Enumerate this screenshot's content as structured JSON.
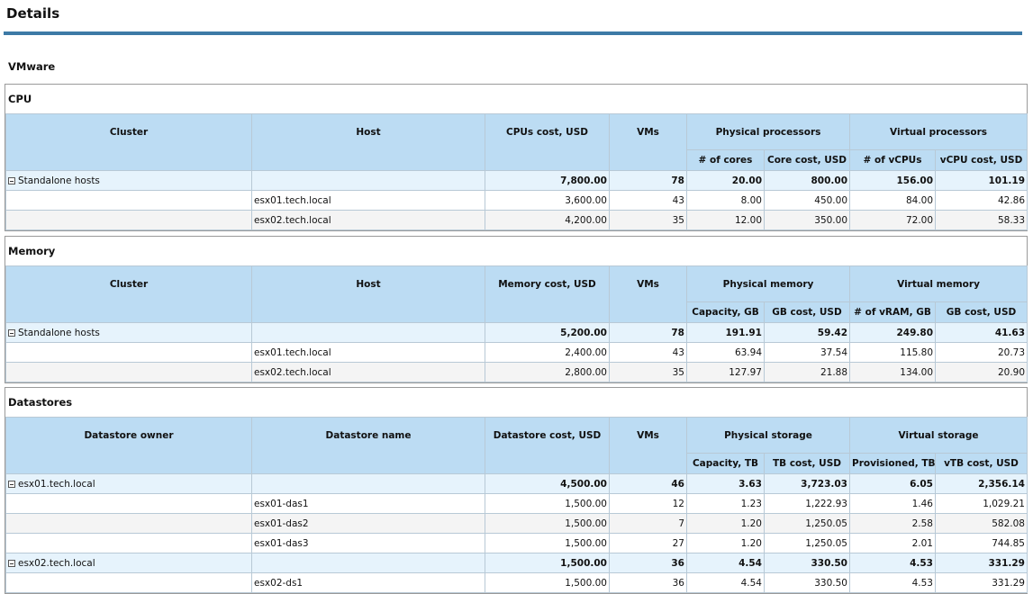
{
  "page": {
    "title": "Details",
    "section": "VMware"
  },
  "cpu": {
    "title": "CPU",
    "headers": {
      "cluster": "Cluster",
      "host": "Host",
      "cost": "CPUs cost, USD",
      "vms": "VMs",
      "phys_group": "Physical processors",
      "virt_group": "Virtual processors",
      "p1": "# of cores",
      "p2": "Core cost, USD",
      "v1": "# of vCPUs",
      "v2": "vCPU cost, USD"
    },
    "rows": [
      {
        "group": true,
        "c0": "Standalone hosts",
        "c1": "",
        "c2": "7,800.00",
        "c3": "78",
        "c4": "20.00",
        "c5": "800.00",
        "c6": "156.00",
        "c7": "101.19"
      },
      {
        "group": false,
        "c0": "",
        "c1": "esx01.tech.local",
        "c2": "3,600.00",
        "c3": "43",
        "c4": "8.00",
        "c5": "450.00",
        "c6": "84.00",
        "c7": "42.86"
      },
      {
        "group": false,
        "c0": "",
        "c1": "esx02.tech.local",
        "c2": "4,200.00",
        "c3": "35",
        "c4": "12.00",
        "c5": "350.00",
        "c6": "72.00",
        "c7": "58.33"
      }
    ]
  },
  "memory": {
    "title": "Memory",
    "headers": {
      "cluster": "Cluster",
      "host": "Host",
      "cost": "Memory cost, USD",
      "vms": "VMs",
      "phys_group": "Physical memory",
      "virt_group": "Virtual memory",
      "p1": "Capacity, GB",
      "p2": "GB cost, USD",
      "v1": "# of vRAM, GB",
      "v2": "GB cost, USD"
    },
    "rows": [
      {
        "group": true,
        "c0": "Standalone hosts",
        "c1": "",
        "c2": "5,200.00",
        "c3": "78",
        "c4": "191.91",
        "c5": "59.42",
        "c6": "249.80",
        "c7": "41.63"
      },
      {
        "group": false,
        "c0": "",
        "c1": "esx01.tech.local",
        "c2": "2,400.00",
        "c3": "43",
        "c4": "63.94",
        "c5": "37.54",
        "c6": "115.80",
        "c7": "20.73"
      },
      {
        "group": false,
        "c0": "",
        "c1": "esx02.tech.local",
        "c2": "2,800.00",
        "c3": "35",
        "c4": "127.97",
        "c5": "21.88",
        "c6": "134.00",
        "c7": "20.90"
      }
    ]
  },
  "datastores": {
    "title": "Datastores",
    "headers": {
      "cluster": "Datastore owner",
      "host": "Datastore name",
      "cost": "Datastore cost, USD",
      "vms": "VMs",
      "phys_group": "Physical storage",
      "virt_group": "Virtual storage",
      "p1": "Capacity, TB",
      "p2": "TB cost, USD",
      "v1": "Provisioned, TB",
      "v2": "vTB cost, USD"
    },
    "rows": [
      {
        "group": true,
        "c0": "esx01.tech.local",
        "c1": "",
        "c2": "4,500.00",
        "c3": "46",
        "c4": "3.63",
        "c5": "3,723.03",
        "c6": "6.05",
        "c7": "2,356.14"
      },
      {
        "group": false,
        "c0": "",
        "c1": "esx01-das1",
        "c2": "1,500.00",
        "c3": "12",
        "c4": "1.23",
        "c5": "1,222.93",
        "c6": "1.46",
        "c7": "1,029.21"
      },
      {
        "group": false,
        "c0": "",
        "c1": "esx01-das2",
        "c2": "1,500.00",
        "c3": "7",
        "c4": "1.20",
        "c5": "1,250.05",
        "c6": "2.58",
        "c7": "582.08"
      },
      {
        "group": false,
        "c0": "",
        "c1": "esx01-das3",
        "c2": "1,500.00",
        "c3": "27",
        "c4": "1.20",
        "c5": "1,250.05",
        "c6": "2.01",
        "c7": "744.85"
      },
      {
        "group": true,
        "c0": "esx02.tech.local",
        "c1": "",
        "c2": "1,500.00",
        "c3": "36",
        "c4": "4.54",
        "c5": "330.50",
        "c6": "4.53",
        "c7": "331.29"
      },
      {
        "group": false,
        "c0": "",
        "c1": "esx02-ds1",
        "c2": "1,500.00",
        "c3": "36",
        "c4": "4.54",
        "c5": "330.50",
        "c6": "4.53",
        "c7": "331.29"
      }
    ]
  }
}
